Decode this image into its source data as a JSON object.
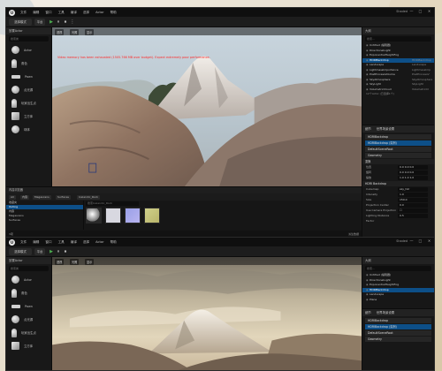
{
  "app": {
    "logo_letter": "U",
    "menu": [
      "文件",
      "编辑",
      "窗口",
      "工具",
      "编译",
      "选择",
      "Actor",
      "帮助"
    ],
    "project": "Outing",
    "brand": "Shaded",
    "window_controls": [
      "—",
      "□",
      "✕"
    ]
  },
  "toolbar": {
    "mode": "选择模式",
    "items": [
      "平台",
      "▶",
      "⏸",
      "⏹",
      "⋮"
    ]
  },
  "place_actors": {
    "title": "放置Actor",
    "search": "搜索类",
    "shapes": [
      "Actor",
      "角色",
      "Pawn",
      "点光源",
      "玩家出生点",
      "立方体",
      "球体"
    ]
  },
  "viewport": {
    "bar_items": [
      "透视",
      "光照",
      "显示"
    ],
    "warning": "Video memory has been exhausted (1505.766 MB over budget). Expect extremely poor performance.",
    "bottom_warning": ""
  },
  "outliner": {
    "title": "大纲",
    "search": "搜索...",
    "rows": [
      {
        "name": "Untitled (编辑器)",
        "type": "",
        "sel": false
      },
      {
        "name": "DirectionalLight",
        "type": "",
        "sel": false
      },
      {
        "name": "ExponentialHeightFog",
        "type": "",
        "sel": false
      },
      {
        "name": "HDRIBackdrop",
        "type": "HDRIBackdrop",
        "sel": true
      },
      {
        "name": "Landscape",
        "type": "Landscape",
        "sel": false
      },
      {
        "name": "LightmassImportance",
        "type": "LightmassImp",
        "sel": false
      },
      {
        "name": "PostProcessVolume",
        "type": "PostProcessV",
        "sel": false
      },
      {
        "name": "SkyAtmosphere",
        "type": "SkyAtmosphere",
        "sel": false
      },
      {
        "name": "SkyLight",
        "type": "SkyLight",
        "sel": false
      },
      {
        "name": "VolumetricCloud",
        "type": "VolumetricCl",
        "sel": false
      }
    ],
    "count": "12个Actor (已选择1个)"
  },
  "details": {
    "tabs": [
      "细节",
      "世界场景设置"
    ],
    "actor": "HDRIBackdrop",
    "components": [
      "HDRIBackdrop (实例)",
      "DefaultSceneRoot",
      "Geometry"
    ],
    "sections": [
      "变换",
      "HDRI Backdrop"
    ],
    "transform": [
      {
        "k": "位置",
        "v": "0.0  0.0  0.0"
      },
      {
        "k": "旋转",
        "v": "0.0  0.0  0.0"
      },
      {
        "k": "缩放",
        "v": "1.0  1.0  1.0"
      }
    ],
    "hdri": [
      {
        "k": "Cubemap",
        "v": "sky_hdr"
      },
      {
        "k": "Intensity",
        "v": "1.0"
      },
      {
        "k": "Size",
        "v": "150.0"
      },
      {
        "k": "Projection Center",
        "v": "0.0"
      },
      {
        "k": "Use Camera Projection",
        "v": "☐"
      },
      {
        "k": "Lighting Distance Factor",
        "v": "0.5"
      }
    ]
  },
  "content_browser": {
    "tab": "内容浏览器",
    "breadcrumb": [
      "All",
      "内容",
      "Megascans",
      "Surfaces",
      "Icelandic_Rock"
    ],
    "filter": "搜索Icelandic_Rock",
    "tree": [
      "收藏夹",
      "Outing",
      "内容",
      "Megascans",
      "Surfaces"
    ],
    "status": "3项",
    "right_status": "派生数据"
  },
  "bottom": {
    "project": "Outing",
    "shapes": [
      "Actor",
      "角色",
      "Pawn",
      "点光源",
      "玩家出生点",
      "立方体",
      "球体"
    ],
    "outliner_rows": [
      {
        "name": "Untitled (编辑器)",
        "sel": false
      },
      {
        "name": "DirectionalLight",
        "sel": false
      },
      {
        "name": "ExponentialHeightFog",
        "sel": false
      },
      {
        "name": "HDRIBackdrop",
        "sel": true
      },
      {
        "name": "Landscape",
        "sel": false
      },
      {
        "name": "Plane",
        "sel": false
      }
    ]
  }
}
